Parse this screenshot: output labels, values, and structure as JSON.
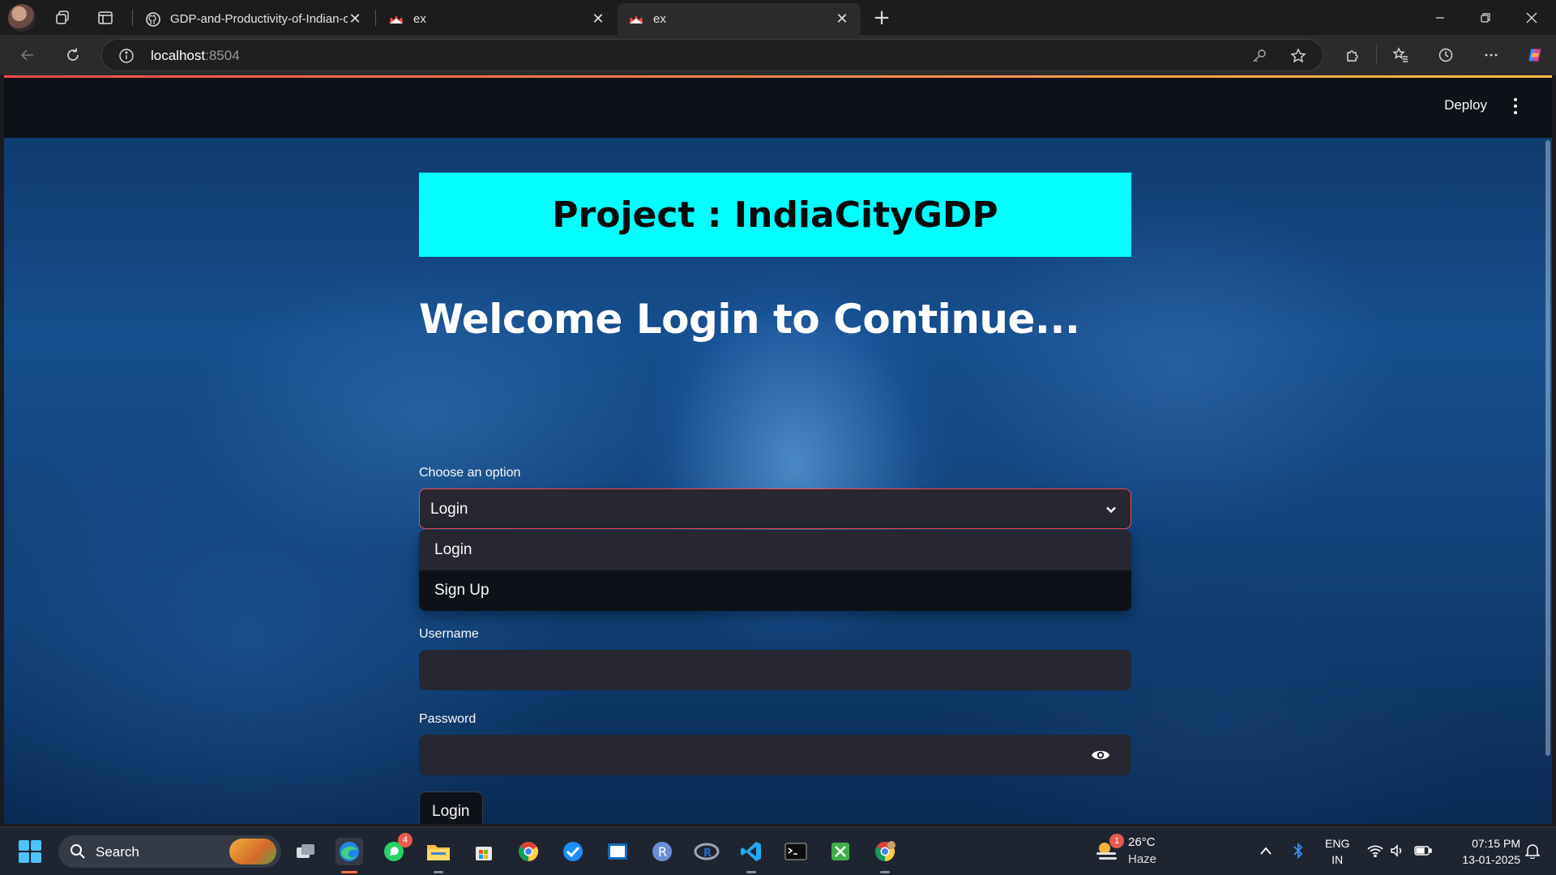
{
  "browser": {
    "tabs": [
      {
        "title": "GDP-and-Productivity-of-Indian-c",
        "favicon": "github-icon"
      },
      {
        "title": "ex",
        "favicon": "streamlit-crown-icon"
      },
      {
        "title": "ex",
        "favicon": "streamlit-crown-icon",
        "active": true
      }
    ],
    "url_host": "localhost",
    "url_port": ":8504"
  },
  "app": {
    "deploy_label": "Deploy",
    "banner_title": "Project : IndiaCityGDP",
    "banner_color": "#00ffff",
    "welcome_heading": "Welcome Login to Continue...",
    "select": {
      "label": "Choose an option",
      "value": "Login",
      "options": [
        "Login",
        "Sign Up"
      ]
    },
    "username_label": "Username",
    "username_value": "",
    "password_label": "Password",
    "password_value": "",
    "login_button": "Login"
  },
  "taskbar": {
    "search_label": "Search",
    "whatsapp_badge": "4",
    "weather_badge": "1",
    "weather_temp": "26°C",
    "weather_desc": "Haze",
    "lang_top": "ENG",
    "lang_bottom": "IN",
    "time": "07:15 PM",
    "date": "13-01-2025"
  },
  "colors": {
    "accent": "#ff4b4b",
    "header_bg": "#0e1117",
    "input_bg": "#262730"
  }
}
